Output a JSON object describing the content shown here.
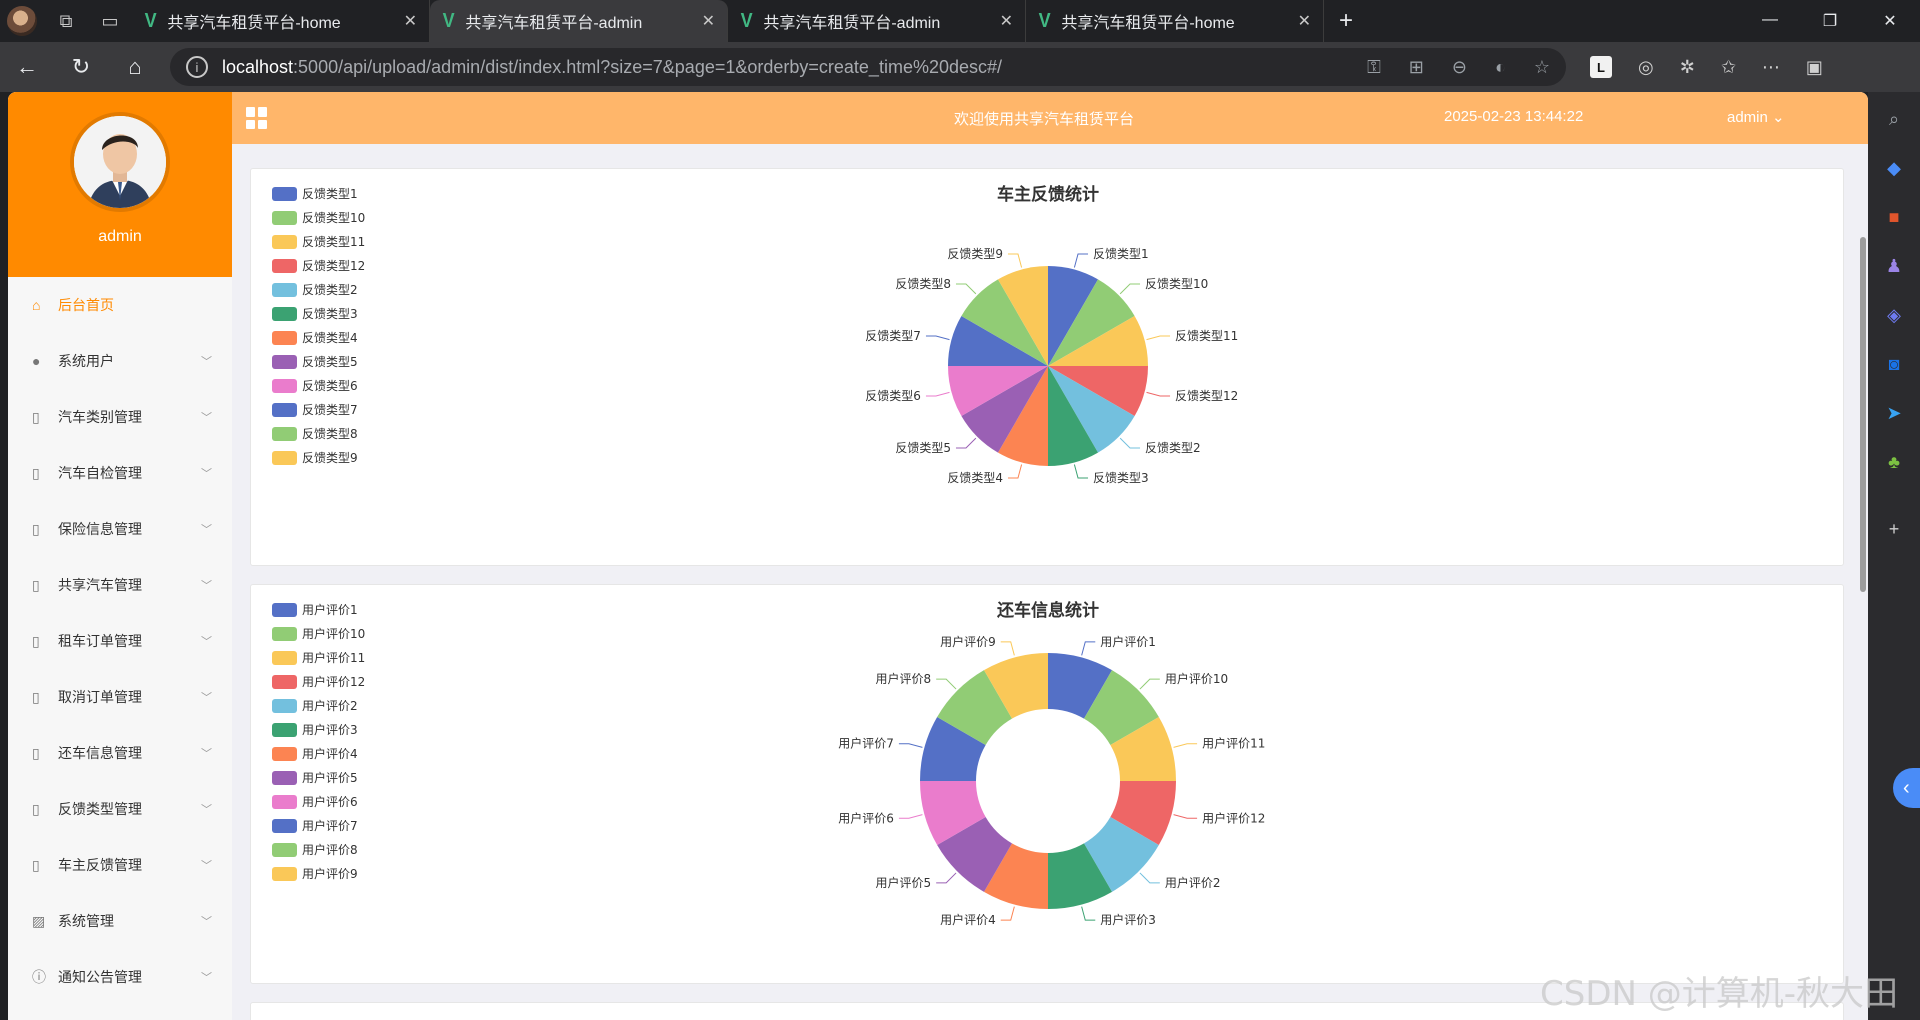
{
  "browser": {
    "tabs": [
      {
        "title": "共享汽车租赁平台-home",
        "active": false
      },
      {
        "title": "共享汽车租赁平台-admin",
        "active": true
      },
      {
        "title": "共享汽车租赁平台-admin",
        "active": false
      },
      {
        "title": "共享汽车租赁平台-home",
        "active": false
      }
    ],
    "url_host": "localhost",
    "url_path": ":5000/api/upload/admin/dist/index.html?size=7&page=1&orderby=create_time%20desc#/"
  },
  "sidebar": {
    "username": "admin",
    "items": [
      {
        "label": "后台首页",
        "icon": "home-icon",
        "active": true,
        "expandable": false
      },
      {
        "label": "系统用户",
        "icon": "user-icon",
        "active": false,
        "expandable": true
      },
      {
        "label": "汽车类别管理",
        "icon": "doc-icon",
        "active": false,
        "expandable": true
      },
      {
        "label": "汽车自检管理",
        "icon": "doc-icon",
        "active": false,
        "expandable": true
      },
      {
        "label": "保险信息管理",
        "icon": "doc-icon",
        "active": false,
        "expandable": true
      },
      {
        "label": "共享汽车管理",
        "icon": "doc-icon",
        "active": false,
        "expandable": true
      },
      {
        "label": "租车订单管理",
        "icon": "doc-icon",
        "active": false,
        "expandable": true
      },
      {
        "label": "取消订单管理",
        "icon": "doc-icon",
        "active": false,
        "expandable": true
      },
      {
        "label": "还车信息管理",
        "icon": "doc-icon",
        "active": false,
        "expandable": true
      },
      {
        "label": "反馈类型管理",
        "icon": "doc-icon",
        "active": false,
        "expandable": true
      },
      {
        "label": "车主反馈管理",
        "icon": "doc-icon",
        "active": false,
        "expandable": true
      },
      {
        "label": "系统管理",
        "icon": "image-icon",
        "active": false,
        "expandable": true
      },
      {
        "label": "通知公告管理",
        "icon": "info-icon",
        "active": false,
        "expandable": true
      }
    ]
  },
  "header": {
    "welcome": "欢迎使用共享汽车租赁平台",
    "datetime": "2025-02-23 13:44:22",
    "user": "admin"
  },
  "colors": {
    "accent": "#ff8a00",
    "topbar": "#ffb66a",
    "palette": [
      "#5470c6",
      "#91cc75",
      "#fac858",
      "#ee6666",
      "#73c0de",
      "#3ba272",
      "#fc8452",
      "#9a60b4",
      "#ea7ccc",
      "#5470c6",
      "#91cc75",
      "#fac858"
    ]
  },
  "chart_data": [
    {
      "type": "pie",
      "title": "车主反馈统计",
      "legend_position": "top-left",
      "categories": [
        "反馈类型1",
        "反馈类型10",
        "反馈类型11",
        "反馈类型12",
        "反馈类型2",
        "反馈类型3",
        "反馈类型4",
        "反馈类型5",
        "反馈类型6",
        "反馈类型7",
        "反馈类型8",
        "反馈类型9"
      ],
      "values": [
        1,
        1,
        1,
        1,
        1,
        1,
        1,
        1,
        1,
        1,
        1,
        1
      ]
    },
    {
      "type": "pie",
      "donut": true,
      "title": "还车信息统计",
      "legend_position": "top-left",
      "categories": [
        "用户评价1",
        "用户评价10",
        "用户评价11",
        "用户评价12",
        "用户评价2",
        "用户评价3",
        "用户评价4",
        "用户评价5",
        "用户评价6",
        "用户评价7",
        "用户评价8",
        "用户评价9"
      ],
      "values": [
        1,
        1,
        1,
        1,
        1,
        1,
        1,
        1,
        1,
        1,
        1,
        1
      ]
    }
  ],
  "watermark": "CSDN @计算机-秋大田"
}
